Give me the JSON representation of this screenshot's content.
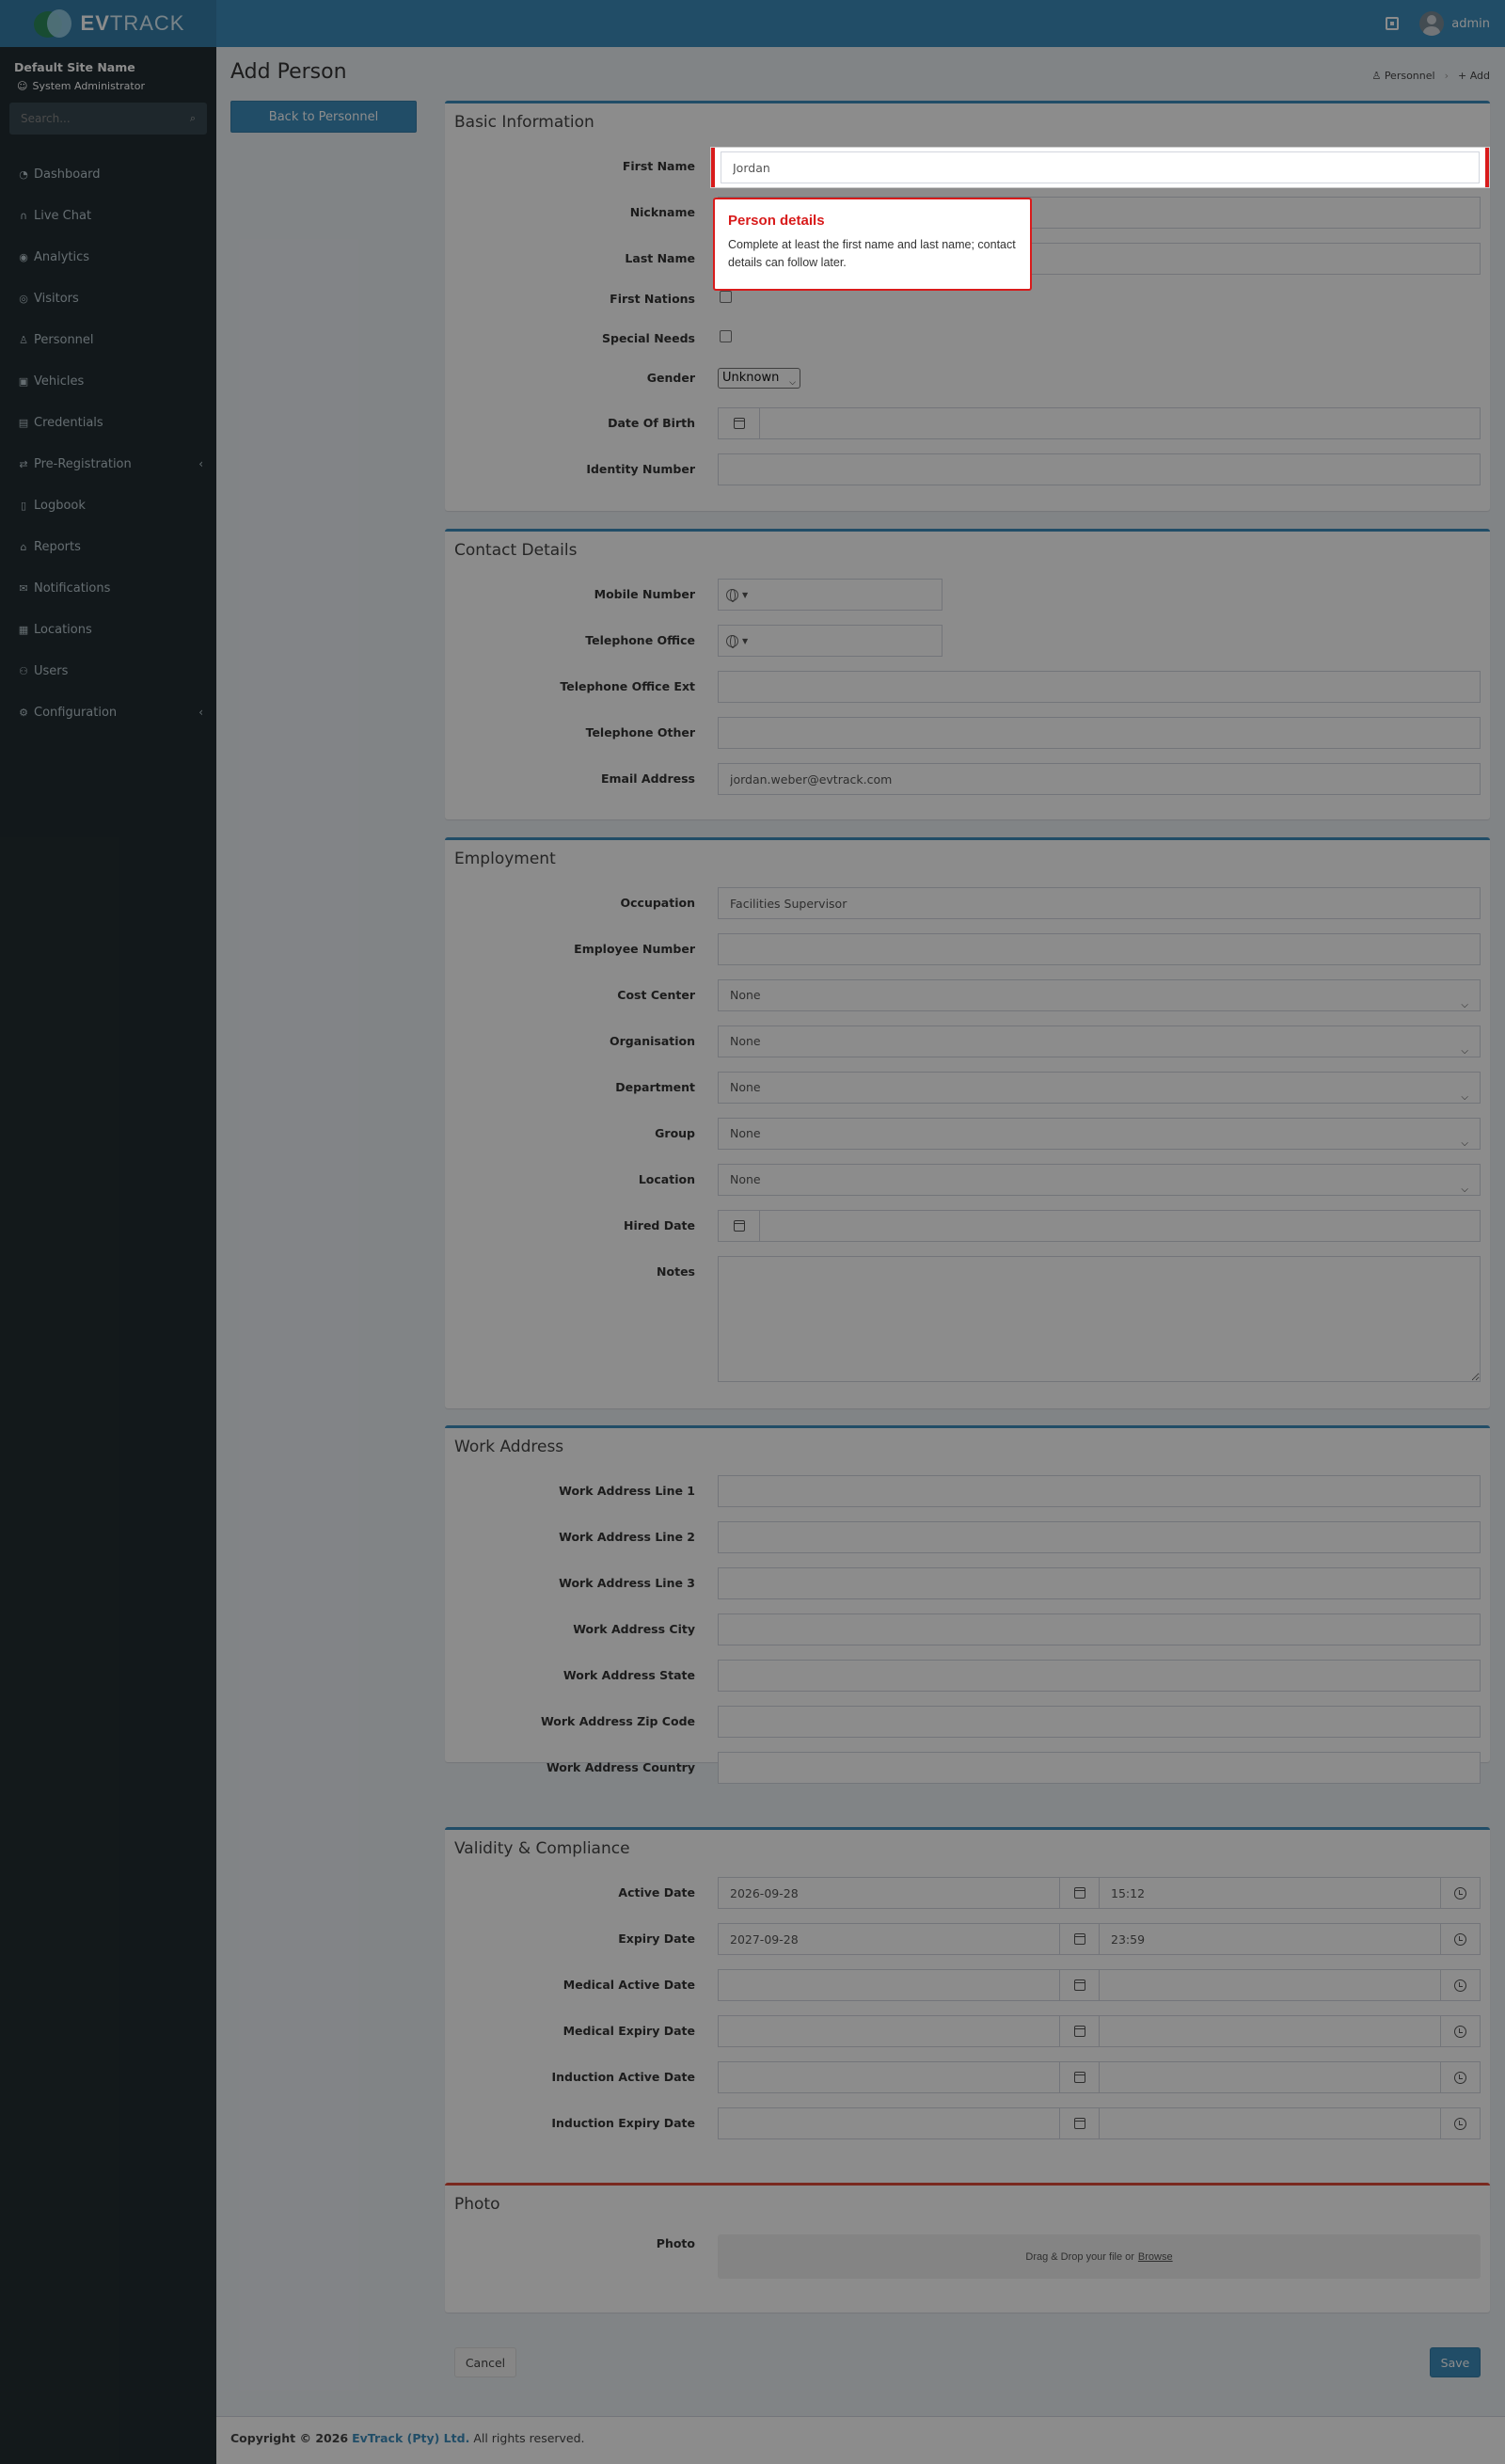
{
  "topbar": {
    "logo_bold": "EV",
    "logo_light": "TRACK",
    "user_name": "admin"
  },
  "sidebar": {
    "site_name": "Default Site Name",
    "role": "System Administrator",
    "search_placeholder": "Search...",
    "items": [
      {
        "label": "Dashboard",
        "icon": "dashboard-icon"
      },
      {
        "label": "Live Chat",
        "icon": "headset-icon"
      },
      {
        "label": "Analytics",
        "icon": "analytics-icon"
      },
      {
        "label": "Visitors",
        "icon": "eye-icon"
      },
      {
        "label": "Personnel",
        "icon": "user-tie-icon"
      },
      {
        "label": "Vehicles",
        "icon": "car-icon"
      },
      {
        "label": "Credentials",
        "icon": "id-card-icon"
      },
      {
        "label": "Pre-Registration",
        "icon": "handshake-icon",
        "expandable": true
      },
      {
        "label": "Logbook",
        "icon": "book-icon"
      },
      {
        "label": "Reports",
        "icon": "reports-icon"
      },
      {
        "label": "Notifications",
        "icon": "envelope-icon"
      },
      {
        "label": "Locations",
        "icon": "building-icon"
      },
      {
        "label": "Users",
        "icon": "users-icon"
      },
      {
        "label": "Configuration",
        "icon": "cog-icon",
        "expandable": true
      }
    ]
  },
  "page": {
    "title": "Add Person",
    "back_button": "Back to Personnel",
    "breadcrumb": [
      "Personnel",
      "Add"
    ]
  },
  "basic": {
    "title": "Basic Information",
    "first_name_label": "First Name",
    "first_name_value": "Jordan",
    "nickname_label": "Nickname",
    "last_name_label": "Last Name",
    "first_nations_label": "First Nations",
    "special_needs_label": "Special Needs",
    "gender_label": "Gender",
    "gender_value": "Unknown",
    "dob_label": "Date Of Birth",
    "identity_label": "Identity Number"
  },
  "contact": {
    "title": "Contact Details",
    "mobile_label": "Mobile Number",
    "tel_office_label": "Telephone Office",
    "tel_office_ext_label": "Telephone Office Ext",
    "tel_other_label": "Telephone Other",
    "email_label": "Email Address",
    "email_value": "jordan.weber@evtrack.com"
  },
  "employment": {
    "title": "Employment",
    "occupation_label": "Occupation",
    "occupation_value": "Facilities Supervisor",
    "employee_number_label": "Employee Number",
    "cost_center_label": "Cost Center",
    "cost_center_value": "None",
    "organisation_label": "Organisation",
    "organisation_value": "None",
    "department_label": "Department",
    "department_value": "None",
    "group_label": "Group",
    "group_value": "None",
    "location_label": "Location",
    "location_value": "None",
    "hired_date_label": "Hired Date",
    "notes_label": "Notes"
  },
  "work_address": {
    "title": "Work Address",
    "line1_label": "Work Address Line 1",
    "line2_label": "Work Address Line 2",
    "line3_label": "Work Address Line 3",
    "city_label": "Work Address City",
    "state_label": "Work Address State",
    "zip_label": "Work Address Zip Code",
    "country_label": "Work Address Country"
  },
  "validity": {
    "title": "Validity & Compliance",
    "active_label": "Active Date",
    "active_date": "2026-09-28",
    "active_time": "15:12",
    "expiry_label": "Expiry Date",
    "expiry_date": "2027-09-28",
    "expiry_time": "23:59",
    "medical_active_label": "Medical Active Date",
    "medical_expiry_label": "Medical Expiry Date",
    "induction_active_label": "Induction Active Date",
    "induction_expiry_label": "Induction Expiry Date"
  },
  "photo": {
    "title": "Photo",
    "label": "Photo",
    "drop_text": "Drag & Drop your file or",
    "browse": "Browse"
  },
  "actions": {
    "cancel": "Cancel",
    "save": "Save"
  },
  "footer": {
    "copyright": "Copyright © 2026",
    "company": "EvTrack (Pty) Ltd.",
    "rights": "All rights reserved."
  },
  "tour": {
    "title": "Person details",
    "body": "Complete at least the first name and last name; contact details can follow later."
  },
  "colors": {
    "primary": "#3c8dbc",
    "sidebar": "#222d32",
    "danger": "#dd4b39",
    "tour_accent": "#d81b1b"
  }
}
